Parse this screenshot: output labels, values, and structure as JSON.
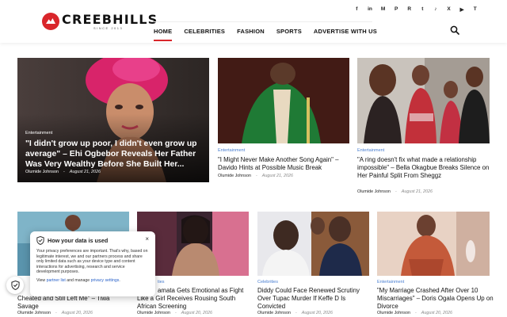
{
  "site": {
    "name": "CREEBHILLS",
    "tagline": "SINCE 2013"
  },
  "social_icons": [
    "facebook-icon",
    "linkedin-icon",
    "medium-icon",
    "pinterest-icon",
    "reddit-icon",
    "tumblr-icon",
    "tiktok-icon",
    "twitter-x-icon",
    "youtube-icon",
    "twitch-icon"
  ],
  "social_glyphs": [
    "f",
    "in",
    "M",
    "P",
    "R",
    "t",
    "♪",
    "X",
    "▶",
    "T"
  ],
  "nav": {
    "items": [
      "HOME",
      "CELEBRITIES",
      "FASHION",
      "SPORTS",
      "ADVERTISE WITH US"
    ],
    "active_index": 0
  },
  "colors": {
    "accent": "#d9262b",
    "category": "#4a7fd1"
  },
  "hero": {
    "category": "Entertainment",
    "title": "\"I didn't grow up poor, I didn't even grow up average\" – Ehi Ogbebor Reveals Her Father Was Very Wealthy Before She Built Her...",
    "author": "Olumide Johnson",
    "date": "August 21, 2026"
  },
  "top_cards": [
    {
      "category": "Entertainment",
      "title": "\"I Might Never Make Another Song Again\" – Davido Hints at Possible Music Break",
      "author": "Olumide Johnson",
      "date": "August 21, 2026"
    },
    {
      "category": "Entertainment",
      "title": "\"A ring doesn't fix what made a relationship impossible\" – Bella Okagbue Breaks Silence on Her Painful Split From Sheggz",
      "author": "Olumide Johnson",
      "date": "August 21, 2026"
    }
  ],
  "bottom_cards": [
    {
      "category": "",
      "title": "Cheated and Still Left Me\" – Tiwa Savage",
      "author": "Olumide Johnson",
      "date": "August 20, 2026"
    },
    {
      "category": "ties",
      "title": "amata Gets Emotional as Fight Like a Girl Receives Rousing South African Screening",
      "author": "Olumide Johnson",
      "date": "August 20, 2026"
    },
    {
      "category": "Celebrities",
      "title": "Diddy Could Face Renewed Scrutiny Over Tupac Murder If Keffe D Is Convicted",
      "author": "Olumide Johnson",
      "date": "August 20, 2026"
    },
    {
      "category": "Entertainment",
      "title": "\"My Marriage Crashed After Over 10 Miscarriages\" – Doris Ogala Opens Up on Divorce",
      "author": "Olumide Johnson",
      "date": "August 20, 2026"
    }
  ],
  "privacy": {
    "title": "How your data is used",
    "body": "Your privacy preferences are important. That's why, based on legitimate interest, we and our partners process and share only limited data such as your device type and content interactions for advertising, research and service development purposes.",
    "links_prefix": "View",
    "partner_link": "partner list",
    "links_middle": "and manage",
    "settings_link": "privacy settings",
    "links_suffix": ".",
    "close": "×"
  },
  "separator": "-"
}
